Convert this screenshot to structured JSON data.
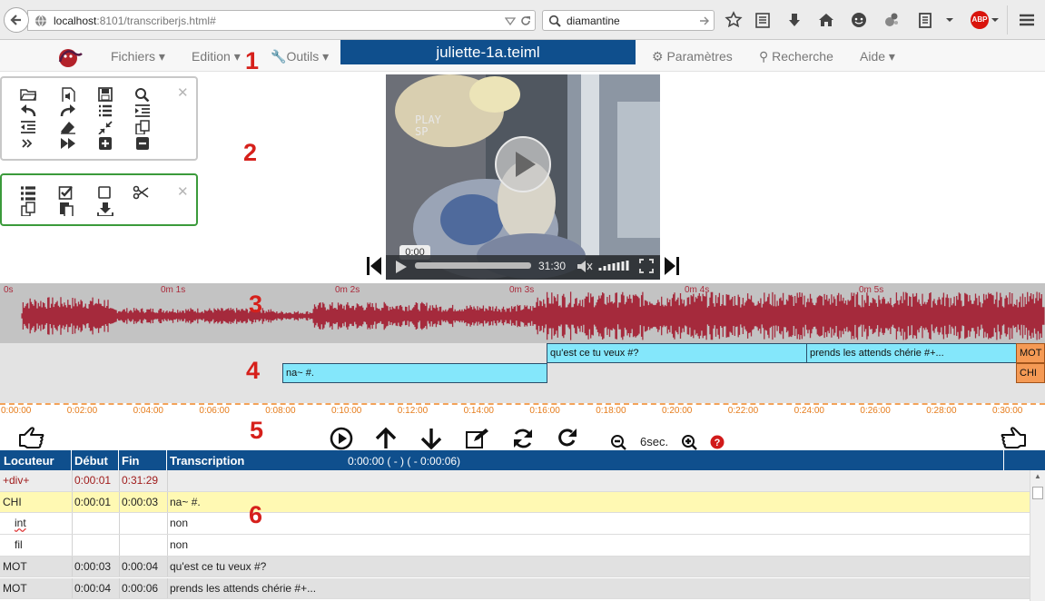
{
  "browser": {
    "url_host": "localhost",
    "url_rest": ":8101/transcriberjs.html#",
    "search_value": "diamantine",
    "abp_label": "ABP"
  },
  "app": {
    "menu": {
      "fichiers": "Fichiers",
      "edition": "Edition",
      "outils": "Outils",
      "parametres": "Paramètres",
      "recherche": "Recherche",
      "aide": "Aide"
    },
    "file_title": "juliette-1a.teiml"
  },
  "annotations": [
    "1",
    "2",
    "3",
    "4",
    "5",
    "6"
  ],
  "video": {
    "overlay_line1": "PLAY",
    "overlay_line2": "SP",
    "time_bubble": "0:00",
    "duration": "31:30",
    "progress": 0
  },
  "waveform": {
    "ticks": [
      "0s",
      "0m 1s",
      "0m 2s",
      "0m 3s",
      "0m 4s",
      "0m 5s"
    ],
    "color": "#a52a3c"
  },
  "segments": [
    {
      "label": "qu'est ce tu veux #?",
      "row": 0,
      "color": "blue"
    },
    {
      "label": "prends les attends chérie #+...",
      "row": 0,
      "color": "blue"
    },
    {
      "label": "MOT",
      "row": 0,
      "color": "orange"
    },
    {
      "label": "na~ #.",
      "row": 1,
      "color": "blue"
    },
    {
      "label": "CHI",
      "row": 1,
      "color": "orange"
    }
  ],
  "timeline": {
    "ticks": [
      "0:00:00",
      "0:02:00",
      "0:04:00",
      "0:06:00",
      "0:08:00",
      "0:10:00",
      "0:12:00",
      "0:14:00",
      "0:16:00",
      "0:18:00",
      "0:20:00",
      "0:22:00",
      "0:24:00",
      "0:26:00",
      "0:28:00",
      "0:30:00"
    ]
  },
  "controls": {
    "zoom_label": "6sec."
  },
  "table": {
    "headers": {
      "locuteur": "Locuteur",
      "debut": "Début",
      "fin": "Fin",
      "transcription": "Transcription",
      "time_info": "0:00:00 ( - )  ( - 0:00:06)"
    },
    "rows": [
      {
        "locuteur": "+div+",
        "debut": "0:00:01",
        "fin": "0:31:29",
        "text": "",
        "style": "div"
      },
      {
        "locuteur": "CHI",
        "debut": "0:00:01",
        "fin": "0:00:03",
        "text": "na~ #.",
        "style": "selected"
      },
      {
        "locuteur": "int",
        "debut": "",
        "fin": "",
        "text": "non",
        "style": "sub"
      },
      {
        "locuteur": "fil",
        "debut": "",
        "fin": "",
        "text": "non",
        "style": "sub"
      },
      {
        "locuteur": "MOT",
        "debut": "0:00:03",
        "fin": "0:00:04",
        "text": "qu'est ce tu veux #?",
        "style": "gray"
      },
      {
        "locuteur": "MOT",
        "debut": "0:00:04",
        "fin": "0:00:06",
        "text": "prends les attends chérie #+...",
        "style": "gray"
      }
    ]
  }
}
